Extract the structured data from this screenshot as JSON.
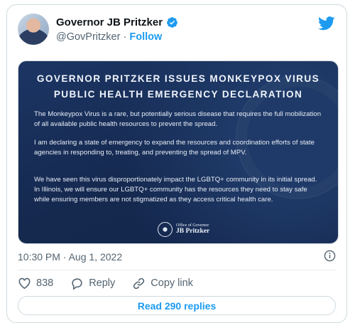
{
  "author": {
    "name": "Governor JB Pritzker",
    "handle": "@GovPritzker",
    "separator": "·",
    "follow_label": "Follow"
  },
  "media": {
    "title": "GOVERNOR PRITZKER ISSUES MONKEYPOX VIRUS PUBLIC HEALTH EMERGENCY DECLARATION",
    "paragraphs": [
      "The Monkeypox Virus is a rare, but potentially serious disease that requires the full mobilization of all available public health resources to prevent the spread.",
      "I am declaring a state of emergency to expand the resources and coordination efforts of state agencies in responding to, treating, and preventing the spread of MPV.",
      "We have seen this virus disproportionately impact the LGBTQ+ community in its initial spread. In Illinois, we will ensure our LGBTQ+ community has the resources they need to stay safe while ensuring members are not stigmatized as they access critical health care."
    ],
    "signature_small": "Office of Governor",
    "signature_name": "JB Pritzker"
  },
  "timestamp": "10:30 PM · Aug 1, 2022",
  "actions": {
    "like_count": "838",
    "reply_label": "Reply",
    "copy_link_label": "Copy link"
  },
  "read_replies_label": "Read 290 replies",
  "colors": {
    "accent": "#1d9bf0",
    "media_background": "#15294f",
    "secondary_text": "#536471"
  },
  "icons": [
    "verified-badge-icon",
    "twitter-bird-icon",
    "info-icon",
    "heart-icon",
    "reply-icon",
    "link-icon",
    "state-seal-icon"
  ]
}
